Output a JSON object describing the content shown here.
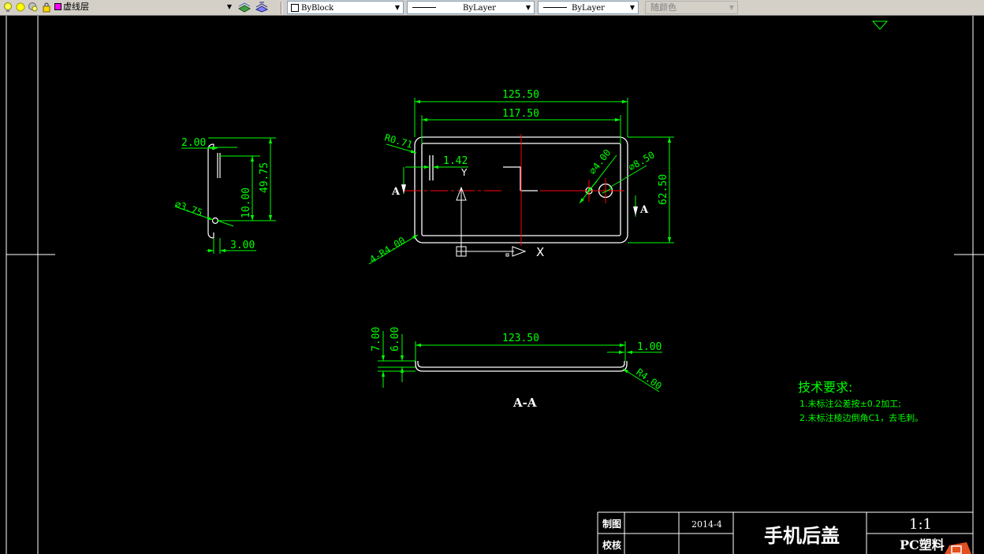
{
  "toolbar": {
    "layer_name": "虚线层",
    "color_value": "ByBlock",
    "linetype_value": "ByLayer",
    "lineweight_value": "ByLayer",
    "plotstyle_value": "随颜色",
    "layer_color": "#ff00ff"
  },
  "drawing": {
    "side_view": {
      "dim_top": "2.00",
      "dim_height": "49.75",
      "dim_hole_pos": "10.00",
      "dim_hole_dia": "⌀3.75",
      "dim_bottom": "3.00"
    },
    "front_view": {
      "dim_overall": "125.50",
      "dim_inner": "117.50",
      "dim_height": "62.50",
      "dim_corner_small": "R0.71",
      "dim_offset": "1.42",
      "dim_hole_small": "⌀4.00",
      "dim_hole_large": "⌀8.50",
      "dim_corner_radius": "4-R4.00",
      "section_mark": "A",
      "axis_x": "X",
      "axis_y": "Y"
    },
    "section_view": {
      "dim_length": "123.50",
      "dim_wall": "1.00",
      "dim_height_total": "7.00",
      "dim_height_inner": "6.00",
      "dim_radius": "R4.00",
      "label": "A-A"
    },
    "notes": {
      "title": "技术要求:",
      "items": [
        "1.未标注公差按±0.2加工;",
        "2.未标注棱边倒角C1，去毛刺。"
      ]
    },
    "title_block": {
      "drawn_label": "制图",
      "checked_label": "校核",
      "date": "2014-4",
      "part_name": "手机后盖",
      "scale": "1:1",
      "material": "PC塑料"
    }
  },
  "colors": {
    "dim": "#00ff00",
    "outline": "#ffffff",
    "center": "#ff0000",
    "background": "#000000"
  }
}
